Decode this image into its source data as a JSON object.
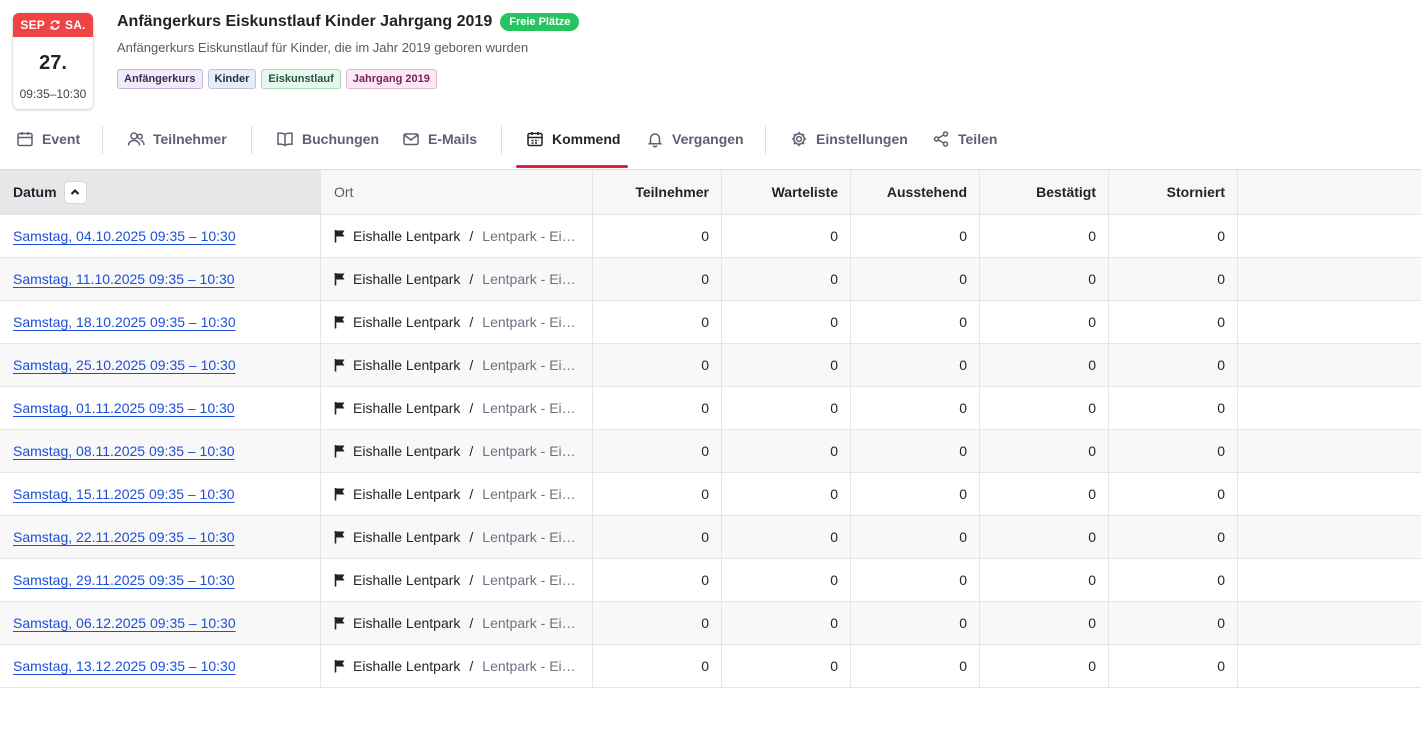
{
  "event": {
    "month": "SEP",
    "weekday": "SA.",
    "day": "27.",
    "time": "09:35–10:30",
    "title": "Anfängerkurs Eiskunstlauf Kinder Jahrgang 2019",
    "status_badge": "Freie Plätze",
    "subtitle": "Anfängerkurs Eiskunstlauf für Kinder, die im Jahr 2019 geboren wurden",
    "tags": [
      "Anfängerkurs",
      "Kinder",
      "Eiskunstlauf",
      "Jahrgang 2019"
    ]
  },
  "tabs": [
    {
      "label": "Event",
      "icon": "calendar-icon"
    },
    {
      "label": "Teilnehmer",
      "icon": "users-icon"
    },
    {
      "label": "Buchungen",
      "icon": "book-icon"
    },
    {
      "label": "E-Mails",
      "icon": "mail-icon"
    },
    {
      "label": "Kommend",
      "icon": "calendar-upcoming-icon",
      "active": true
    },
    {
      "label": "Vergangen",
      "icon": "bell-icon"
    },
    {
      "label": "Einstellungen",
      "icon": "gear-icon"
    },
    {
      "label": "Teilen",
      "icon": "share-icon"
    }
  ],
  "table": {
    "columns": [
      "Datum",
      "Ort",
      "Teilnehmer",
      "Warteliste",
      "Ausstehend",
      "Bestätigt",
      "Storniert"
    ],
    "rows": [
      {
        "date": "Samstag, 04.10.2025 09:35 – 10:30",
        "location": "Eishalle Lentpark",
        "sublocation": "Lentpark - Eisfläche",
        "values": [
          "0",
          "0",
          "0",
          "0",
          "0"
        ]
      },
      {
        "date": "Samstag, 11.10.2025 09:35 – 10:30",
        "location": "Eishalle Lentpark",
        "sublocation": "Lentpark - Eisfläche",
        "values": [
          "0",
          "0",
          "0",
          "0",
          "0"
        ]
      },
      {
        "date": "Samstag, 18.10.2025 09:35 – 10:30",
        "location": "Eishalle Lentpark",
        "sublocation": "Lentpark - Eisfläche",
        "values": [
          "0",
          "0",
          "0",
          "0",
          "0"
        ]
      },
      {
        "date": "Samstag, 25.10.2025 09:35 – 10:30",
        "location": "Eishalle Lentpark",
        "sublocation": "Lentpark - Eisfläche",
        "values": [
          "0",
          "0",
          "0",
          "0",
          "0"
        ]
      },
      {
        "date": "Samstag, 01.11.2025 09:35 – 10:30",
        "location": "Eishalle Lentpark",
        "sublocation": "Lentpark - Eisfläche",
        "values": [
          "0",
          "0",
          "0",
          "0",
          "0"
        ]
      },
      {
        "date": "Samstag, 08.11.2025 09:35 – 10:30",
        "location": "Eishalle Lentpark",
        "sublocation": "Lentpark - Eisfläche",
        "values": [
          "0",
          "0",
          "0",
          "0",
          "0"
        ]
      },
      {
        "date": "Samstag, 15.11.2025 09:35 – 10:30",
        "location": "Eishalle Lentpark",
        "sublocation": "Lentpark - Eisfläche",
        "values": [
          "0",
          "0",
          "0",
          "0",
          "0"
        ]
      },
      {
        "date": "Samstag, 22.11.2025 09:35 – 10:30",
        "location": "Eishalle Lentpark",
        "sublocation": "Lentpark - Eisfläche",
        "values": [
          "0",
          "0",
          "0",
          "0",
          "0"
        ]
      },
      {
        "date": "Samstag, 29.11.2025 09:35 – 10:30",
        "location": "Eishalle Lentpark",
        "sublocation": "Lentpark - Eisfläche",
        "values": [
          "0",
          "0",
          "0",
          "0",
          "0"
        ]
      },
      {
        "date": "Samstag, 06.12.2025 09:35 – 10:30",
        "location": "Eishalle Lentpark",
        "sublocation": "Lentpark - Eisfläche",
        "values": [
          "0",
          "0",
          "0",
          "0",
          "0"
        ]
      },
      {
        "date": "Samstag, 13.12.2025 09:35 – 10:30",
        "location": "Eishalle Lentpark",
        "sublocation": "Lentpark - Eisfläche",
        "values": [
          "0",
          "0",
          "0",
          "0",
          "0"
        ]
      }
    ]
  },
  "colors": {
    "accent": "#e11d48",
    "badge_free": "#22c55e",
    "date_strip": "#ef4444",
    "link": "#1d4ed8"
  }
}
